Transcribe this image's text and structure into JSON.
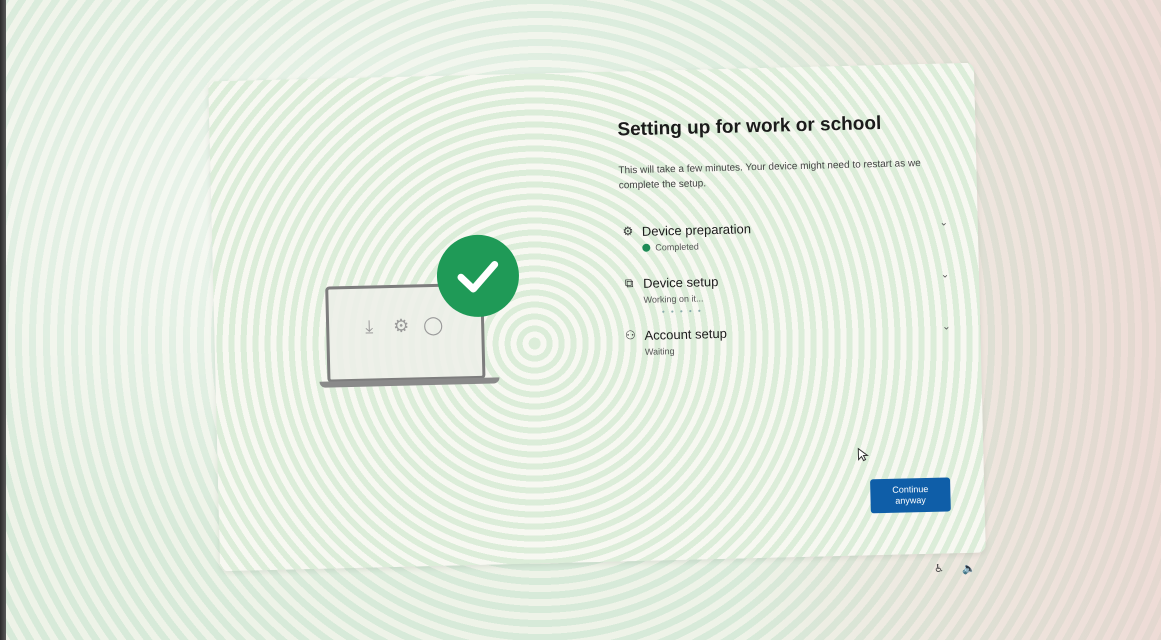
{
  "setup": {
    "title": "Setting up for work or school",
    "subtitle": "This will take a few minutes. Your device might need to restart as we complete the setup.",
    "steps": [
      {
        "label": "Device preparation",
        "icon": "gear-icon",
        "status": "Completed",
        "state": "completed"
      },
      {
        "label": "Device setup",
        "icon": "device-setup-icon",
        "status": "Working on it...",
        "state": "in-progress"
      },
      {
        "label": "Account setup",
        "icon": "users-icon",
        "status": "Waiting",
        "state": "waiting"
      }
    ],
    "continue_button": "Continue anyway"
  },
  "colors": {
    "accent": "#0f5ea8",
    "success": "#1f9a57"
  }
}
